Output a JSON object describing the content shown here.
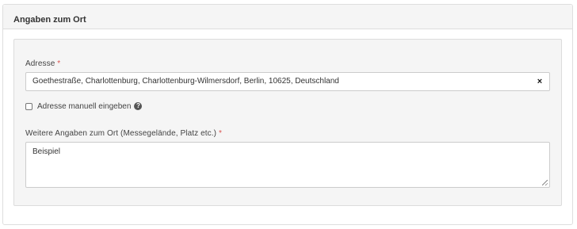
{
  "panel": {
    "title": "Angaben zum Ort"
  },
  "address": {
    "label": "Adresse",
    "required_mark": "*",
    "value": "Goethestraße, Charlottenburg, Charlottenburg-Wilmersdorf, Berlin, 10625, Deutschland",
    "clear_icon": "×"
  },
  "manual": {
    "label": "Adresse manuell eingeben",
    "checked": false,
    "help_icon": "?"
  },
  "details": {
    "label": "Weitere Angaben zum Ort (Messegelände, Platz etc.)",
    "required_mark": "*",
    "value": "Beispiel"
  },
  "colors": {
    "required": "#d9534f",
    "panel_header_bg": "#f5f5f5",
    "well_bg": "#f5f5f5"
  }
}
